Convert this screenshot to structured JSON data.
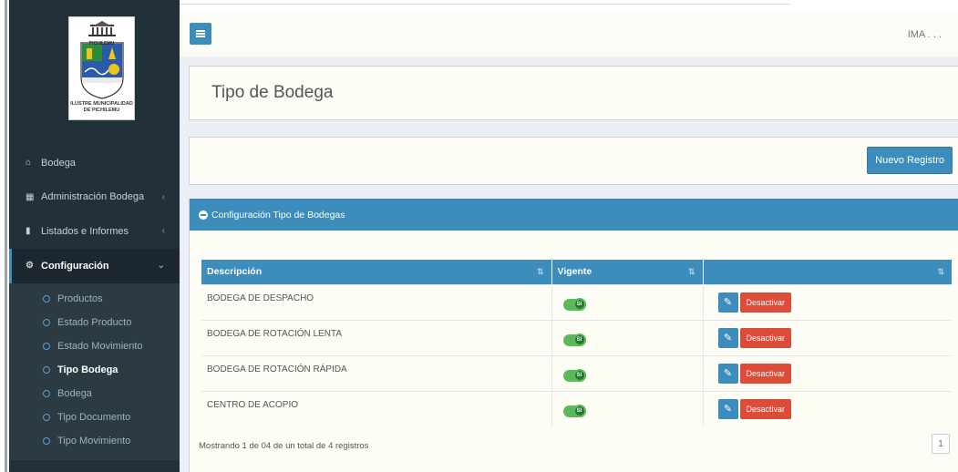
{
  "sidebar": {
    "logo": {
      "city": "PICHILEMU",
      "caption_line1": "ILUSTRE MUNICIPALIDAD",
      "caption_line2": "DE PICHILEMU"
    },
    "items": [
      {
        "label": "Bodega",
        "icon": "home-icon"
      },
      {
        "label": "Administración Bodega",
        "icon": "table-icon"
      },
      {
        "label": "Listados e Informes",
        "icon": "file-icon"
      },
      {
        "label": "Configuración",
        "icon": "cogs-icon"
      }
    ],
    "submenu": [
      {
        "label": "Productos"
      },
      {
        "label": "Estado Producto"
      },
      {
        "label": "Estado Movimiento"
      },
      {
        "label": "Tipo Bodega"
      },
      {
        "label": "Bodega"
      },
      {
        "label": "Tipo Documento"
      },
      {
        "label": "Tipo Movimiento"
      }
    ]
  },
  "navbar": {
    "user_label": "IMA . . ."
  },
  "page": {
    "title": "Tipo de Bodega",
    "new_button": "Nuevo Registro"
  },
  "table_box": {
    "header": "Configuración Tipo de Bodegas",
    "columns": [
      "Descripción",
      "Vigente",
      ""
    ],
    "rows": [
      {
        "descripcion": "BODEGA DE DESPACHO",
        "vigente": "SI",
        "action": "Desactivar"
      },
      {
        "descripcion": "BODEGA DE ROTACIÓN LENTA",
        "vigente": "SI",
        "action": "Desactivar"
      },
      {
        "descripcion": "BODEGA DE ROTACIÓN RÁPIDA",
        "vigente": "SI",
        "action": "Desactivar"
      },
      {
        "descripcion": "CENTRO DE ACOPIO",
        "vigente": "SI",
        "action": "Desactivar"
      }
    ],
    "footer_info": "Mostrando 1 de 04 de un total de 4 registros",
    "page_number": "1"
  },
  "colors": {
    "sidebar_bg": "#22303a",
    "accent": "#3c8dbc",
    "danger": "#dd4b39",
    "toggle_on": "#5cb85c"
  }
}
